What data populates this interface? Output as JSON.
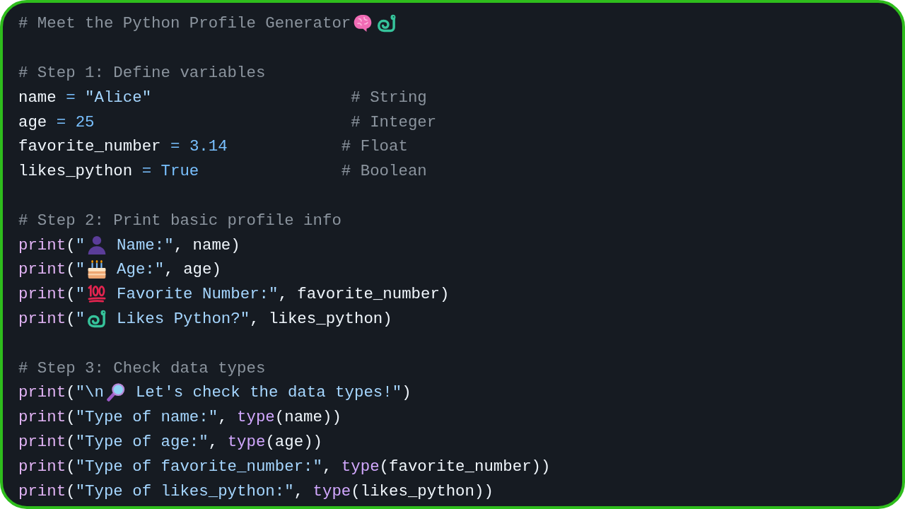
{
  "code_block": {
    "sections": [
      {
        "lines": [
          {
            "tokens": [
              {
                "kind": "comment",
                "text": "# Meet the Python Profile Generator"
              },
              {
                "kind": "icon"
              },
              {
                "kind": "icon"
              }
            ]
          }
        ]
      },
      {
        "lines": [
          {
            "tokens": [
              {
                "kind": "comment",
                "text": "# Step 1: Define variables"
              }
            ]
          },
          {
            "tokens": [
              {
                "kind": "name",
                "text": "name"
              },
              {
                "kind": "op",
                "text": " = "
              },
              {
                "kind": "string",
                "text": "\"Alice\""
              },
              {
                "kind": "comment",
                "text": "                     # String"
              }
            ]
          },
          {
            "tokens": [
              {
                "kind": "name",
                "text": "age"
              },
              {
                "kind": "op",
                "text": " = "
              },
              {
                "kind": "number",
                "text": "25"
              },
              {
                "kind": "comment",
                "text": "                           # Integer"
              }
            ]
          },
          {
            "tokens": [
              {
                "kind": "name",
                "text": "favorite_number"
              },
              {
                "kind": "op",
                "text": " = "
              },
              {
                "kind": "number",
                "text": "3.14"
              },
              {
                "kind": "comment",
                "text": "            # Float"
              }
            ]
          },
          {
            "tokens": [
              {
                "kind": "name",
                "text": "likes_python"
              },
              {
                "kind": "op",
                "text": " = "
              },
              {
                "kind": "constant",
                "text": "True"
              },
              {
                "kind": "comment",
                "text": "               # Boolean"
              }
            ]
          }
        ]
      },
      {
        "lines": [
          {
            "tokens": [
              {
                "kind": "comment",
                "text": "# Step 2: Print basic profile info"
              }
            ]
          },
          {
            "tokens": [
              {
                "kind": "call",
                "text": "print"
              },
              {
                "kind": "punct",
                "text": "("
              },
              {
                "kind": "string",
                "text": "\""
              },
              {
                "kind": "icon"
              },
              {
                "kind": "string",
                "text": "Name:\""
              },
              {
                "kind": "punct",
                "text": ", "
              },
              {
                "kind": "name",
                "text": "name"
              },
              {
                "kind": "punct",
                "text": ")"
              }
            ]
          },
          {
            "tokens": [
              {
                "kind": "call",
                "text": "print"
              },
              {
                "kind": "punct",
                "text": "("
              },
              {
                "kind": "string",
                "text": "\""
              },
              {
                "kind": "icon"
              },
              {
                "kind": "string",
                "text": "Age:\""
              },
              {
                "kind": "punct",
                "text": ", "
              },
              {
                "kind": "name",
                "text": "age"
              },
              {
                "kind": "punct",
                "text": ")"
              }
            ]
          },
          {
            "tokens": [
              {
                "kind": "call",
                "text": "print"
              },
              {
                "kind": "punct",
                "text": "("
              },
              {
                "kind": "string",
                "text": "\""
              },
              {
                "kind": "icon"
              },
              {
                "kind": "string",
                "text": "Favorite Number:\""
              },
              {
                "kind": "punct",
                "text": ", "
              },
              {
                "kind": "name",
                "text": "favorite_number"
              },
              {
                "kind": "punct",
                "text": ")"
              }
            ]
          },
          {
            "tokens": [
              {
                "kind": "call",
                "text": "print"
              },
              {
                "kind": "punct",
                "text": "("
              },
              {
                "kind": "string",
                "text": "\""
              },
              {
                "kind": "icon"
              },
              {
                "kind": "string",
                "text": "Likes Python?\""
              },
              {
                "kind": "punct",
                "text": ", "
              },
              {
                "kind": "name",
                "text": "likes_python"
              },
              {
                "kind": "punct",
                "text": ")"
              }
            ]
          }
        ]
      },
      {
        "lines": [
          {
            "tokens": [
              {
                "kind": "comment",
                "text": "# Step 3: Check data types"
              }
            ]
          },
          {
            "tokens": [
              {
                "kind": "call",
                "text": "print"
              },
              {
                "kind": "punct",
                "text": "("
              },
              {
                "kind": "string",
                "text": "\"\\n"
              },
              {
                "kind": "icon"
              },
              {
                "kind": "string",
                "text": "Let's check the data types!\""
              },
              {
                "kind": "punct",
                "text": ")"
              }
            ]
          },
          {
            "tokens": [
              {
                "kind": "call",
                "text": "print"
              },
              {
                "kind": "punct",
                "text": "("
              },
              {
                "kind": "string",
                "text": "\"Type of name:\""
              },
              {
                "kind": "punct",
                "text": ", "
              },
              {
                "kind": "builtin",
                "text": "type"
              },
              {
                "kind": "punct",
                "text": "("
              },
              {
                "kind": "name",
                "text": "name"
              },
              {
                "kind": "punct",
                "text": "))"
              }
            ]
          },
          {
            "tokens": [
              {
                "kind": "call",
                "text": "print"
              },
              {
                "kind": "punct",
                "text": "("
              },
              {
                "kind": "string",
                "text": "\"Type of age:\""
              },
              {
                "kind": "punct",
                "text": ", "
              },
              {
                "kind": "builtin",
                "text": "type"
              },
              {
                "kind": "punct",
                "text": "("
              },
              {
                "kind": "name",
                "text": "age"
              },
              {
                "kind": "punct",
                "text": "))"
              }
            ]
          },
          {
            "tokens": [
              {
                "kind": "call",
                "text": "print"
              },
              {
                "kind": "punct",
                "text": "("
              },
              {
                "kind": "string",
                "text": "\"Type of favorite_number:\""
              },
              {
                "kind": "punct",
                "text": ", "
              },
              {
                "kind": "builtin",
                "text": "type"
              },
              {
                "kind": "punct",
                "text": "("
              },
              {
                "kind": "name",
                "text": "favorite_number"
              },
              {
                "kind": "punct",
                "text": "))"
              }
            ]
          },
          {
            "tokens": [
              {
                "kind": "call",
                "text": "print"
              },
              {
                "kind": "punct",
                "text": "("
              },
              {
                "kind": "string",
                "text": "\"Type of likes_python:\""
              },
              {
                "kind": "punct",
                "text": ", "
              },
              {
                "kind": "builtin",
                "text": "type"
              },
              {
                "kind": "punct",
                "text": "("
              },
              {
                "kind": "name",
                "text": "likes_python"
              },
              {
                "kind": "punct",
                "text": "))"
              }
            ]
          }
        ]
      }
    ]
  }
}
